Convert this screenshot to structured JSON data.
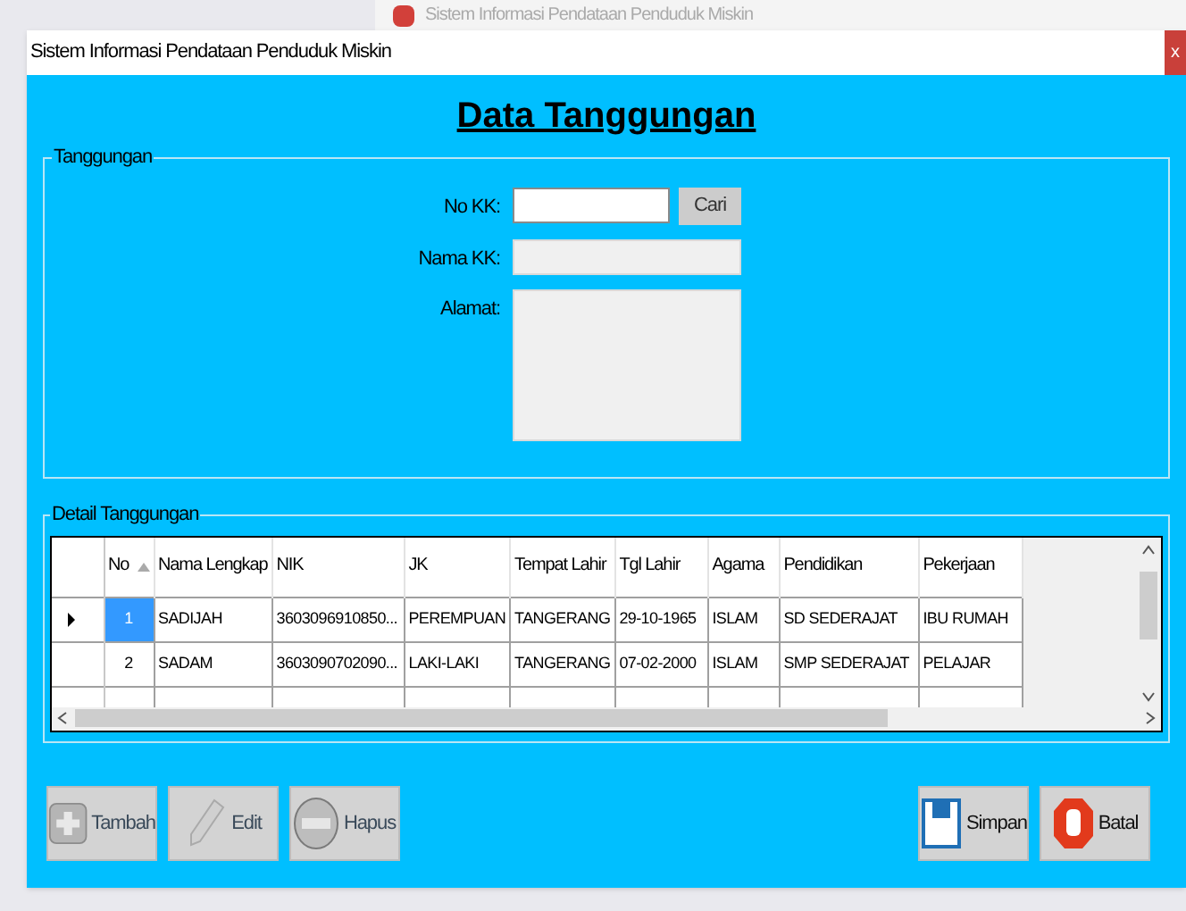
{
  "background_window": {
    "title": "Sistem Informasi Pendataan Penduduk Miskin"
  },
  "window": {
    "title": "Sistem Informasi Pendataan Penduduk Miskin",
    "close": "x"
  },
  "heading": "Data Tanggungan",
  "tanggungan_group": {
    "title": "Tanggungan",
    "fields": [
      {
        "label": "No KK:",
        "kind": "input",
        "disabled": false,
        "button": "Cari"
      },
      {
        "label": "Nama KK:",
        "kind": "input",
        "disabled": true
      },
      {
        "label": "Alamat:",
        "kind": "textarea",
        "disabled": true
      }
    ]
  },
  "detail_group": {
    "title": "Detail Tanggungan",
    "table": {
      "columns": [
        "No",
        "Nama Lengkap",
        "NIK",
        "JK",
        "Tempat Lahir",
        "Tgl Lahir",
        "Agama",
        "Pendidikan",
        "Pekerjaan"
      ],
      "rows": [
        {
          "selected": true,
          "cells": [
            "1",
            "SADIJAH",
            "3603096910850...",
            "PEREMPUAN",
            "TANGERANG",
            "29-10-1965",
            "ISLAM",
            "SD SEDERAJAT",
            "IBU RUMAH"
          ]
        },
        {
          "selected": false,
          "cells": [
            "2",
            "SADAM",
            "3603090702090...",
            "LAKI-LAKI",
            "TANGERANG",
            "07-02-2000",
            "ISLAM",
            "SMP SEDERAJAT",
            "PELAJAR"
          ]
        }
      ]
    }
  },
  "buttons_left": [
    {
      "label": "Tambah",
      "kind": "add",
      "disabled": true
    },
    {
      "label": "Edit",
      "kind": "edit",
      "disabled": true
    },
    {
      "label": "Hapus",
      "kind": "remove",
      "disabled": true
    }
  ],
  "buttons_right": [
    {
      "label": "Simpan",
      "kind": "save",
      "disabled": false
    },
    {
      "label": "Batal",
      "kind": "cancel",
      "disabled": false
    }
  ]
}
